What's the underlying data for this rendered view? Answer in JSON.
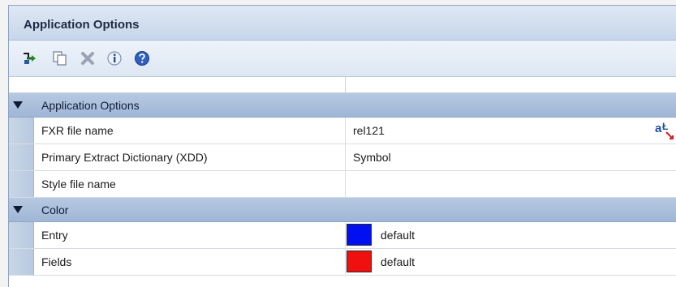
{
  "panel": {
    "title": "Application Options"
  },
  "toolbar": {
    "icons": [
      "sort-icon",
      "copy-icon",
      "delete-icon",
      "info-icon",
      "help-icon"
    ]
  },
  "categories": [
    {
      "label": "Application Options",
      "properties": [
        {
          "name": "FXR file name",
          "value": "rel121"
        },
        {
          "name": "Primary Extract Dictionary (XDD)",
          "value": "Symbol"
        },
        {
          "name": "Style file name",
          "value": ""
        }
      ]
    },
    {
      "label": "Color",
      "properties": [
        {
          "name": "Entry",
          "value": "default",
          "color": "#0010f0"
        },
        {
          "name": "Fields",
          "value": "default",
          "color": "#f01010"
        }
      ]
    }
  ]
}
